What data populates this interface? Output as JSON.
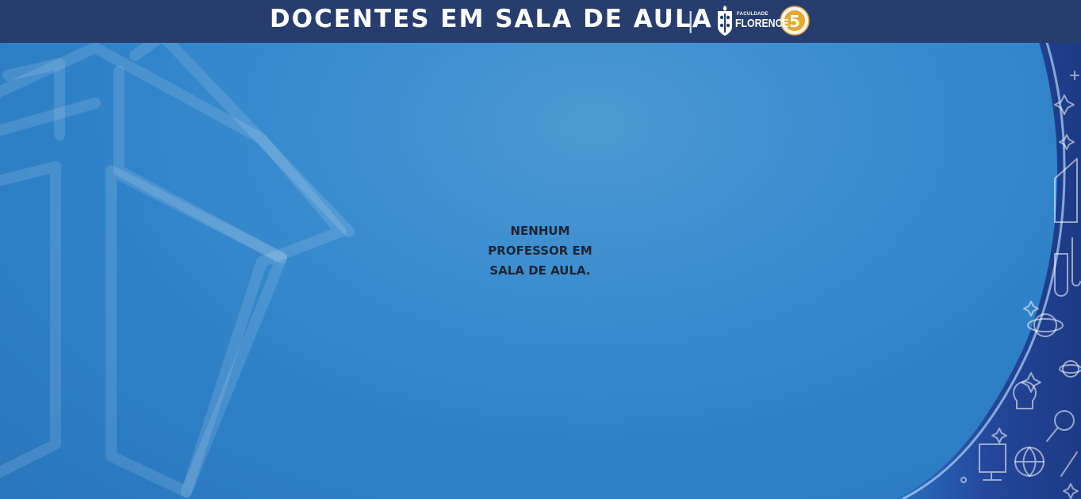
{
  "header": {
    "title": "DOCENTES EM SALA DE AULA",
    "separator": "|",
    "logo": {
      "line1": "FACULDADE",
      "line2": "FLORENCE",
      "badge": "5",
      "icon": "florence-crest-icon"
    }
  },
  "main": {
    "empty_message": "NENHUM PROFESSOR EM SALA DE AULA."
  },
  "colors": {
    "header_bg": "#263d6d",
    "background": "#3a8ccf",
    "accent_dark": "#1f3f8a",
    "text_dark": "#1e2433"
  }
}
